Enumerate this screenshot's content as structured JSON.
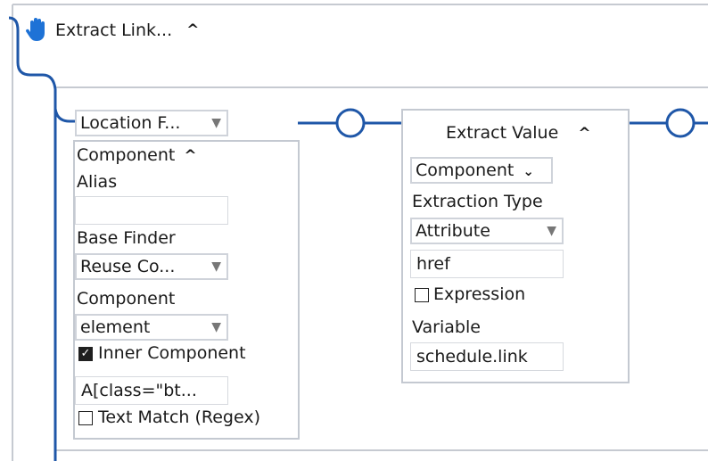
{
  "top_block": {
    "title": "Extract Link...",
    "chevron": "^"
  },
  "location_finder": {
    "select_label": "Location F...",
    "component_header": "Component",
    "chevron": "^",
    "alias_label": "Alias",
    "alias_value": "",
    "base_finder_label": "Base Finder",
    "base_finder_value": "Reuse Co...",
    "component_label": "Component",
    "component_value": "element",
    "inner_component_label": "Inner Component",
    "inner_component_checked": true,
    "selector_value": "A[class=\"bt...",
    "text_match_label": "Text Match (Regex)",
    "text_match_checked": false
  },
  "extract_value": {
    "title": "Extract Value",
    "chevron": "^",
    "component_select": "Component",
    "extraction_type_label": "Extraction Type",
    "extraction_type_value": "Attribute",
    "attribute_value": "href",
    "expression_label": "Expression",
    "expression_checked": false,
    "variable_label": "Variable",
    "variable_value": "schedule.link"
  },
  "icons": {
    "hand": "hand-icon",
    "dropdown": "dropdown-arrow-icon",
    "small_chevron_down": "chevron-down-icon"
  },
  "colors": {
    "connector_blue": "#1f57a8",
    "hand_blue": "#1e72d6",
    "border_gray": "#c4c9d1"
  }
}
